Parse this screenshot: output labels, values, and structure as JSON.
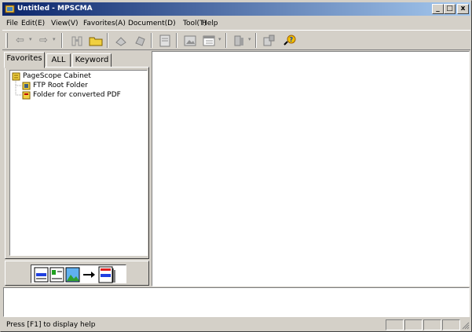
{
  "window": {
    "title": "Untitled - MPSCMA",
    "min": "_",
    "max": "□",
    "close": "x"
  },
  "menu": [
    "File",
    "Edit(E)",
    "View(V)",
    "Favorites(A)",
    "Document(D)",
    "Tool(T)",
    "Help"
  ],
  "toolbar": {
    "back_icon": "arrow-left-icon",
    "forward_icon": "arrow-right-icon",
    "dropdown_glyph": "▾"
  },
  "tabs": [
    "Favorites",
    "ALL",
    "Keyword"
  ],
  "tree": {
    "root": "PageScope Cabinet",
    "children": [
      "FTP Root Folder",
      "Folder for converted PDF"
    ]
  },
  "status": {
    "text": "Press [F1] to display help"
  },
  "colors": {
    "title_start": "#0a246a",
    "title_end": "#a6caf0",
    "face": "#d4d0c8"
  }
}
